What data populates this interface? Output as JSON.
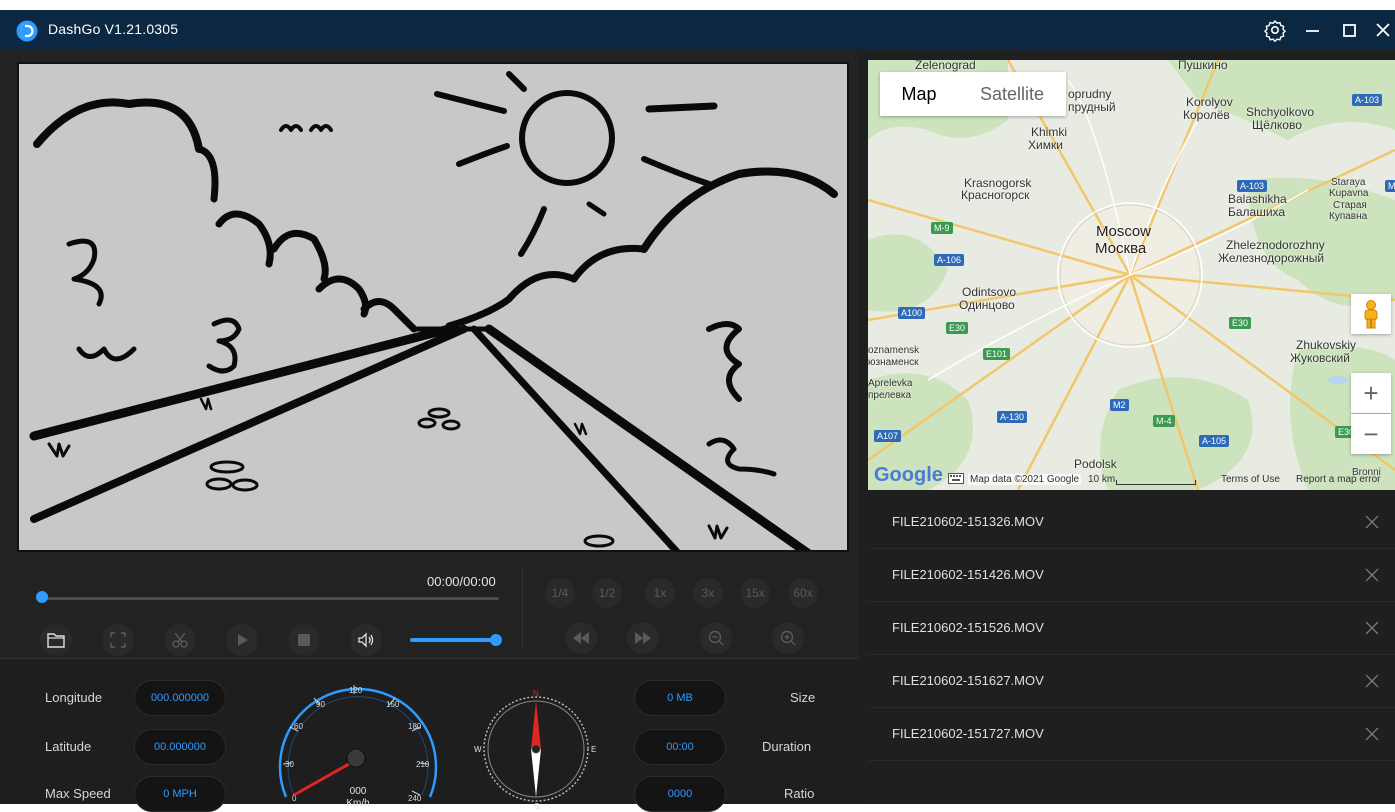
{
  "window": {
    "title": "DashGo V1.21.0305"
  },
  "player": {
    "time": "00:00/00:00",
    "progress": 0,
    "volume": 1.0,
    "speeds": [
      "1/4",
      "1/2",
      "1x",
      "3x",
      "15x",
      "60x"
    ]
  },
  "info": {
    "longitude_label": "Longitude",
    "longitude_value": "000.000000",
    "latitude_label": "Latitude",
    "latitude_value": "00.000000",
    "max_speed_label": "Max Speed",
    "max_speed_value": "0 MPH",
    "size_label": "Size",
    "size_value": "0 MB",
    "duration_label": "Duration",
    "duration_value": "00:00",
    "ratio_label": "Ratio",
    "ratio_value": "0000"
  },
  "speedometer": {
    "ticks": [
      "0",
      "30",
      "60",
      "90",
      "120",
      "150",
      "180",
      "210",
      "240"
    ],
    "value": "000",
    "unit": "Km/h"
  },
  "compass": {
    "n": "N",
    "s": "S",
    "e": "E",
    "w": "W"
  },
  "map": {
    "tab_map": "Map",
    "tab_satellite": "Satellite",
    "zoom_in": "+",
    "zoom_out": "−",
    "logo": "Google",
    "data_text": "Map data ©2021 Google",
    "scale_text": "10 km",
    "terms": "Terms of Use",
    "report": "Report a map error",
    "labels": {
      "zelenograd": "Zelenograd",
      "pushkino": "Пушкино",
      "dolgoprudny": "oprudny",
      "dolgoprudny_ru": "прудный",
      "korolyov": "Korolyov",
      "korolyov_ru": "Королёв",
      "shchyolkovo": "Shchyolkovo",
      "shchyolkovo_ru": "Щёлково",
      "khimki": "Khimki",
      "khimki_ru": "Химки",
      "krasnogorsk": "Krasnogorsk",
      "krasnogorsk_ru": "Красногорск",
      "staraya": "Staraya",
      "kupavna": "Kupavna",
      "staraya_ru": "Старая",
      "kupavna_ru": "Купавна",
      "balashikha": "Balashikha",
      "balashikha_ru": "Балашиха",
      "moscow": "Moscow",
      "moscow_ru": "Москва",
      "zheleznodorozhny": "Zheleznodorozhny",
      "zheleznodorozhny_ru": "Железнодорожный",
      "odintsovo": "Odintsovo",
      "odintsovo_ru": "Одинцово",
      "znamensk": "oznamensk",
      "znamensk_ru": "юзнаменск",
      "zhukovskiy": "Zhukovskiy",
      "zhukovskiy_ru": "Жуковский",
      "aprelevka": "Aprelevka",
      "aprelevka_ru": "прелевка",
      "podolsk": "Podolsk",
      "bronnitsy": "Bronni"
    },
    "roads": {
      "a103_top": "A-103",
      "a103_mid": "A-103",
      "m9": "M-9",
      "a106": "A-106",
      "a100": "A100",
      "e30_left": "E30",
      "e101": "E101",
      "e30_right": "E30",
      "m2": "M2",
      "m4": "M-4",
      "a130": "A-130",
      "a107": "A107",
      "a105": "A-105",
      "e30_far": "E30",
      "m_right": "M"
    }
  },
  "files": [
    "FILE210602-151326.MOV",
    "FILE210602-151426.MOV",
    "FILE210602-151526.MOV",
    "FILE210602-151627.MOV",
    "FILE210602-151727.MOV"
  ]
}
